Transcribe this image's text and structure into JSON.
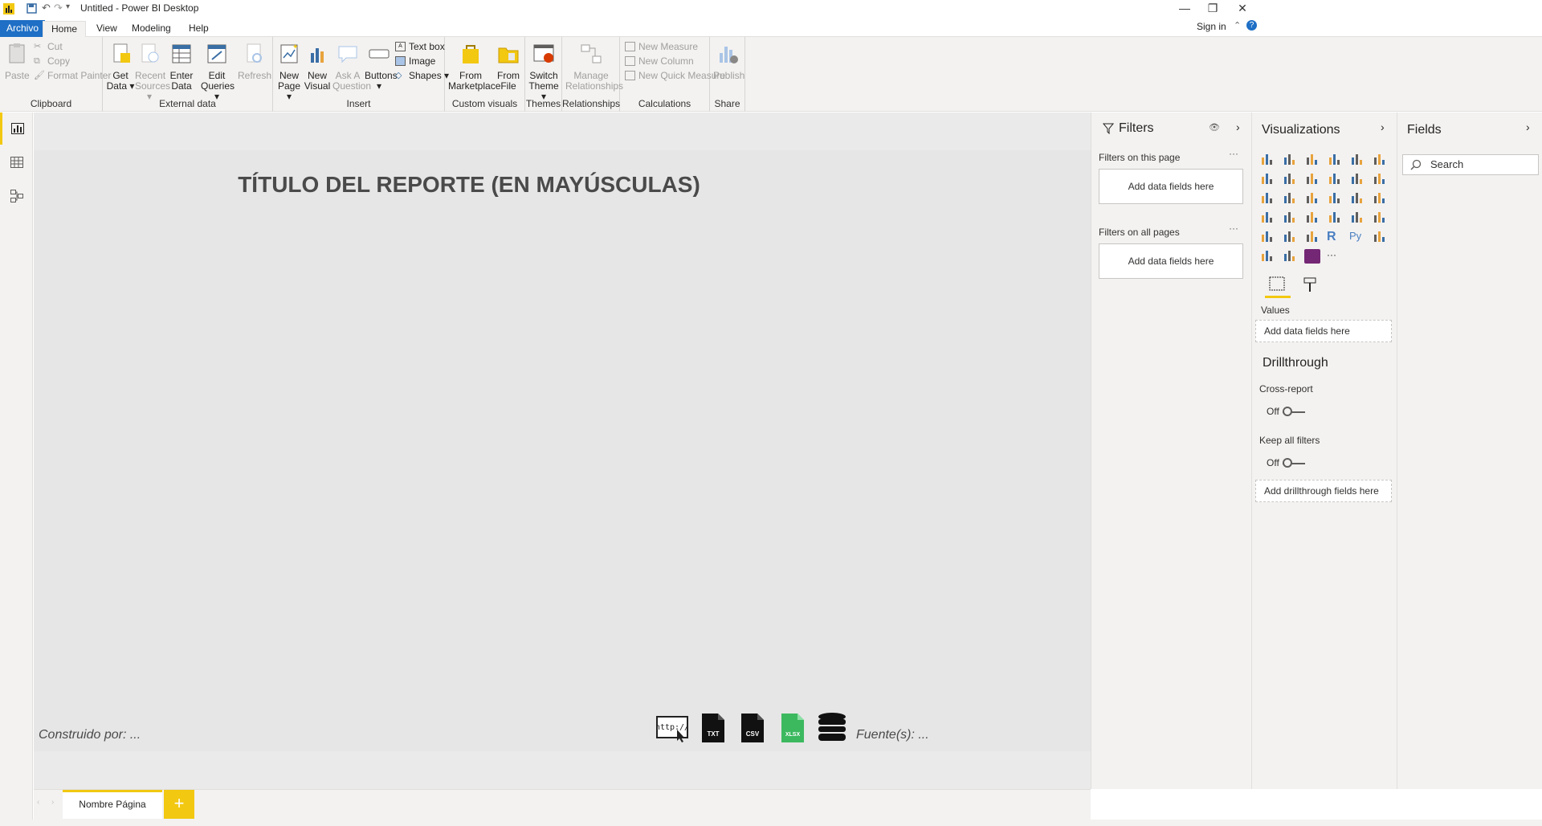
{
  "window": {
    "title": "Untitled - Power BI Desktop",
    "sign_in": "Sign in"
  },
  "menu": {
    "tabs": [
      "Archivo",
      "Home",
      "View",
      "Modeling",
      "Help"
    ]
  },
  "ribbon": {
    "clipboard": {
      "label": "Clipboard",
      "paste": "Paste",
      "cut": "Cut",
      "copy": "Copy",
      "format_painter": "Format Painter"
    },
    "external_data": {
      "label": "External data",
      "get_data": [
        "Get",
        "Data ▾"
      ],
      "recent_sources": [
        "Recent",
        "Sources ▾"
      ],
      "enter_data": [
        "Enter",
        "Data"
      ],
      "edit_queries": [
        "Edit",
        "Queries ▾"
      ],
      "refresh": "Refresh"
    },
    "insert": {
      "label": "Insert",
      "new_page": [
        "New",
        "Page ▾"
      ],
      "new_visual": [
        "New",
        "Visual"
      ],
      "ask_question": [
        "Ask A",
        "Question"
      ],
      "buttons": [
        "Buttons",
        "▾"
      ],
      "text_box": "Text box",
      "image": "Image",
      "shapes": "Shapes ▾"
    },
    "custom_visuals": {
      "label": "Custom visuals",
      "from_marketplace": [
        "From",
        "Marketplace"
      ],
      "from_file": [
        "From",
        "File"
      ]
    },
    "themes": {
      "label": "Themes",
      "switch_theme": [
        "Switch",
        "Theme ▾"
      ]
    },
    "relationships": {
      "label": "Relationships",
      "manage": [
        "Manage",
        "Relationships"
      ]
    },
    "calculations": {
      "label": "Calculations",
      "new_measure": "New Measure",
      "new_column": "New Column",
      "new_quick_measure": "New Quick Measure"
    },
    "share": {
      "label": "Share",
      "publish": "Publish"
    }
  },
  "canvas": {
    "title": "TÍTULO DEL REPORTE (EN MAYÚSCULAS)",
    "built_by": "Construido por: ...",
    "sources": "Fuente(s): ...",
    "source_icons": [
      {
        "name": "url-icon",
        "text": "http://"
      },
      {
        "name": "txt-file-icon",
        "text": "TXT"
      },
      {
        "name": "csv-file-icon",
        "text": "CSV"
      },
      {
        "name": "xlsx-file-icon",
        "text": "XLSX"
      },
      {
        "name": "database-icon",
        "text": ""
      }
    ]
  },
  "page_tabs": {
    "current": "Nombre Página",
    "add": "+"
  },
  "filters": {
    "title": "Filters",
    "on_this_page": "Filters on this page",
    "on_all_pages": "Filters on all pages",
    "add_fields": "Add data fields here",
    "more": "···"
  },
  "visualizations": {
    "title": "Visualizations",
    "values_label": "Values",
    "values_box": "Add data fields here",
    "drillthrough": "Drillthrough",
    "cross_report": "Cross-report",
    "cross_report_state": "Off",
    "keep_all_filters": "Keep all filters",
    "keep_all_filters_state": "Off",
    "drillthrough_box": "Add drillthrough fields here",
    "more": "···"
  },
  "fields": {
    "title": "Fields",
    "search_placeholder": "Search"
  },
  "colors": {
    "accent": "#f2c811",
    "archivo_tab": "#1e6fc5",
    "pane_bg": "#f3f2f1"
  }
}
